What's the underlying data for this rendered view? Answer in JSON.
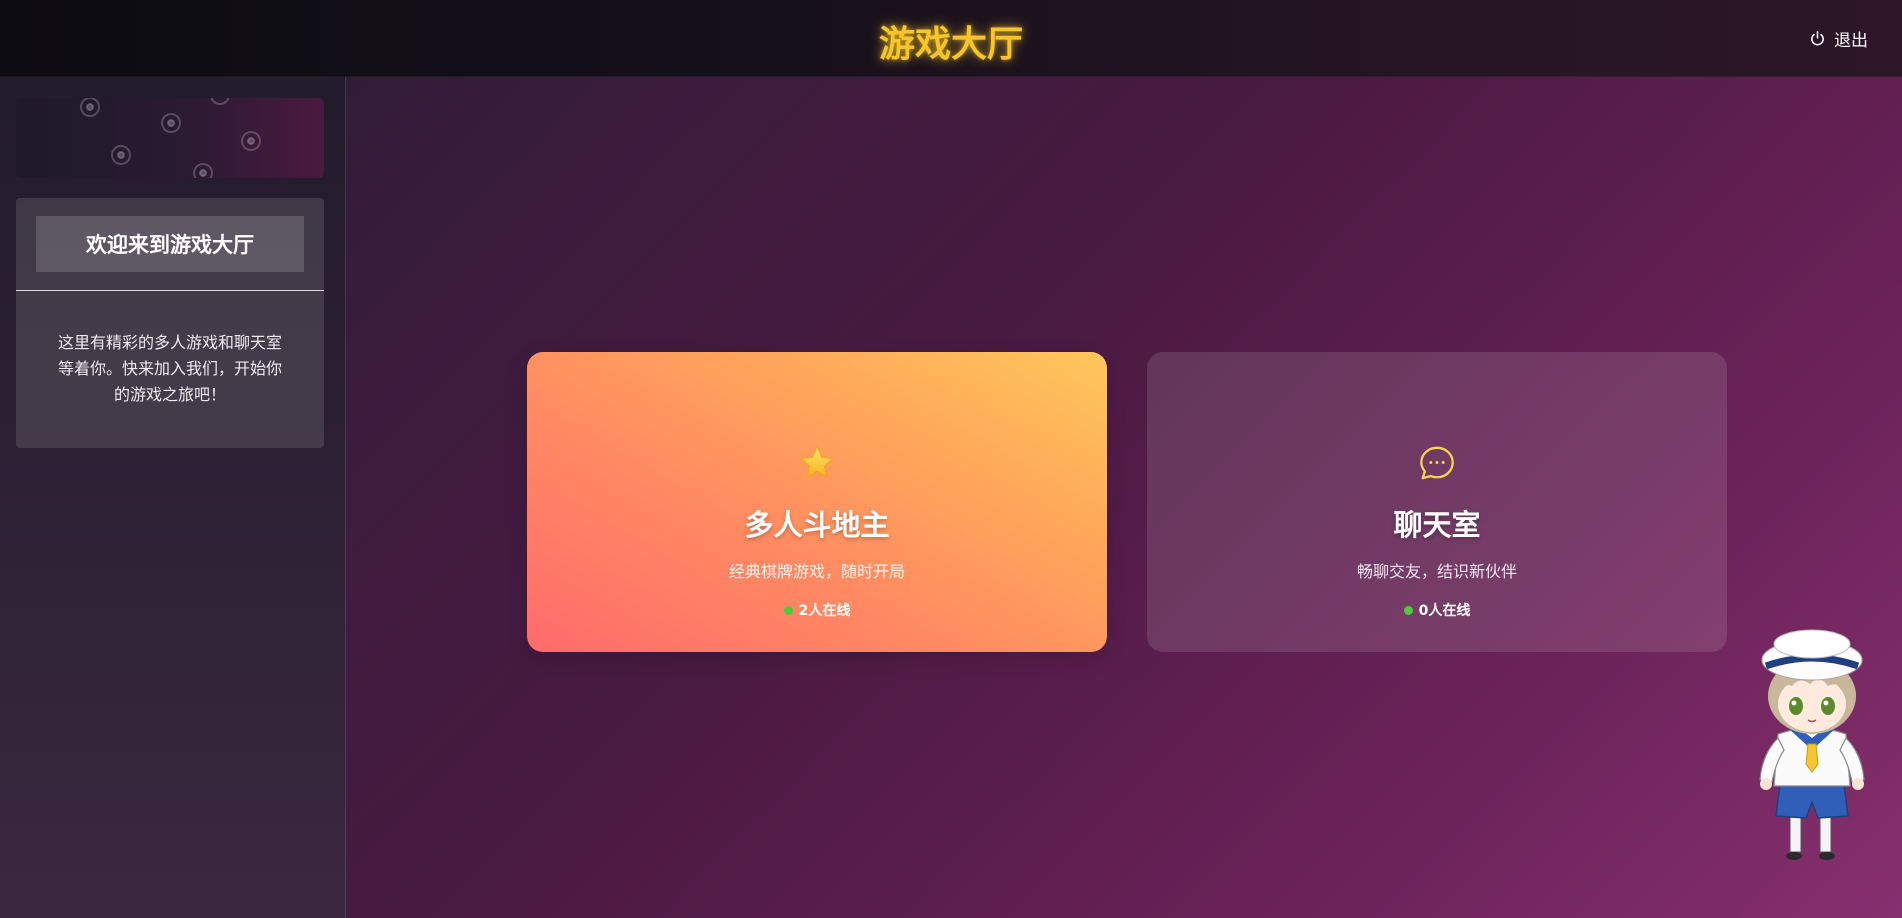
{
  "header": {
    "title": "游戏大厅",
    "logout_label": "退出",
    "logout_icon": "power-icon"
  },
  "sidebar": {
    "welcome_title": "欢迎来到游戏大厅",
    "welcome_text": "这里有精彩的多人游戏和聊天室等着你。快来加入我们，开始你的游戏之旅吧！"
  },
  "cards": [
    {
      "icon": "star-icon",
      "title": "多人斗地主",
      "subtitle": "经典棋牌游戏，随时开局",
      "online": "2人在线"
    },
    {
      "icon": "chat-bubble-icon",
      "title": "聊天室",
      "subtitle": "畅聊交友，结识新伙伴",
      "online": "0人在线"
    }
  ],
  "colors": {
    "title_gold": "#f7c52a",
    "online_green": "#4ccc3a",
    "game_card_start": "#ff6b6b",
    "game_card_end": "#fec75a"
  }
}
